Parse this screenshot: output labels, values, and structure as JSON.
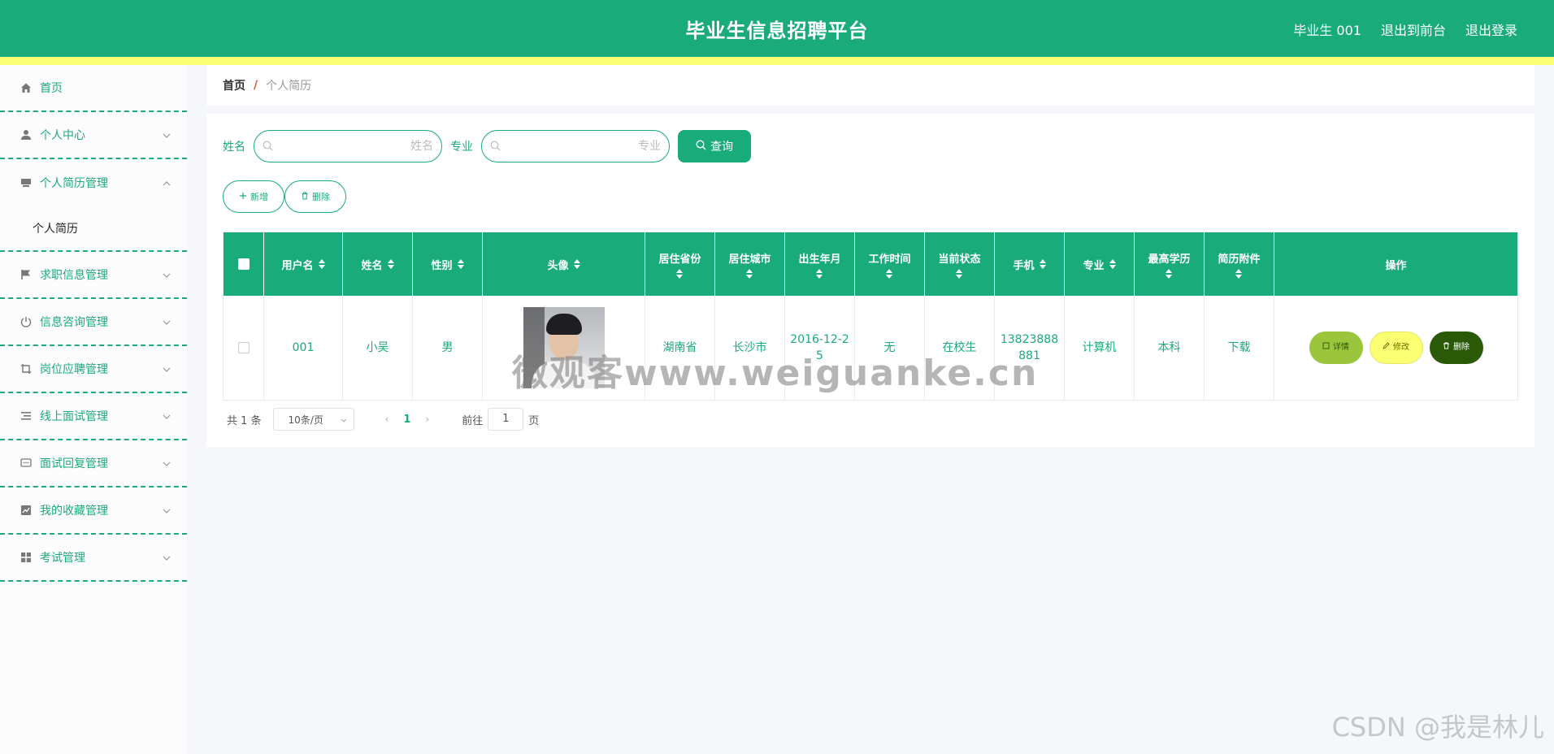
{
  "header": {
    "title": "毕业生信息招聘平台",
    "user": "毕业生 001",
    "to_front": "退出到前台",
    "logout": "退出登录"
  },
  "sidebar": {
    "items": [
      {
        "label": "首页",
        "icon": "home-icon"
      },
      {
        "label": "个人中心",
        "icon": "user-icon"
      },
      {
        "label": "个人简历管理",
        "icon": "inbox-icon",
        "open": true
      },
      {
        "label": "求职信息管理",
        "icon": "flag-icon"
      },
      {
        "label": "信息咨询管理",
        "icon": "power-icon"
      },
      {
        "label": "岗位应聘管理",
        "icon": "crop-icon"
      },
      {
        "label": "线上面试管理",
        "icon": "list-icon"
      },
      {
        "label": "面试回复管理",
        "icon": "chat-icon"
      },
      {
        "label": "我的收藏管理",
        "icon": "chart-icon"
      },
      {
        "label": "考试管理",
        "icon": "grid-icon"
      }
    ],
    "submenu_label": "个人简历"
  },
  "breadcrumb": {
    "home": "首页",
    "sep": "/",
    "current": "个人简历"
  },
  "search": {
    "name_label": "姓名",
    "name_placeholder": "姓名",
    "major_label": "专业",
    "major_placeholder": "专业",
    "query_label": "查询"
  },
  "actions": {
    "add": "新增",
    "delete": "删除"
  },
  "table": {
    "headers": [
      "用户名",
      "姓名",
      "性别",
      "头像",
      "居住省份",
      "居住城市",
      "出生年月",
      "工作时间",
      "当前状态",
      "手机",
      "专业",
      "最高学历",
      "简历附件",
      "操作"
    ],
    "rows": [
      {
        "username": "001",
        "name": "小吴",
        "gender": "男",
        "province": "湖南省",
        "city": "长沙市",
        "birth": "2016-12-25",
        "work_time": "无",
        "status": "在校生",
        "phone": "13823888881",
        "major": "计算机",
        "education": "本科",
        "attachment": "下载",
        "ops": {
          "detail": "详情",
          "edit": "修改",
          "delete": "删除"
        }
      }
    ]
  },
  "pagination": {
    "total": "共 1 条",
    "page_size": "10条/页",
    "current": "1",
    "goto_prefix": "前往",
    "goto_value": "1",
    "goto_suffix": "页"
  },
  "watermarks": {
    "site": "微观客www.weiguanke.cn",
    "csdn": "CSDN @我是林儿"
  },
  "colors": {
    "primary": "#1aab7b",
    "stripe": "#fbff72",
    "detail": "#9bc53d",
    "delete": "#2a5a08"
  }
}
